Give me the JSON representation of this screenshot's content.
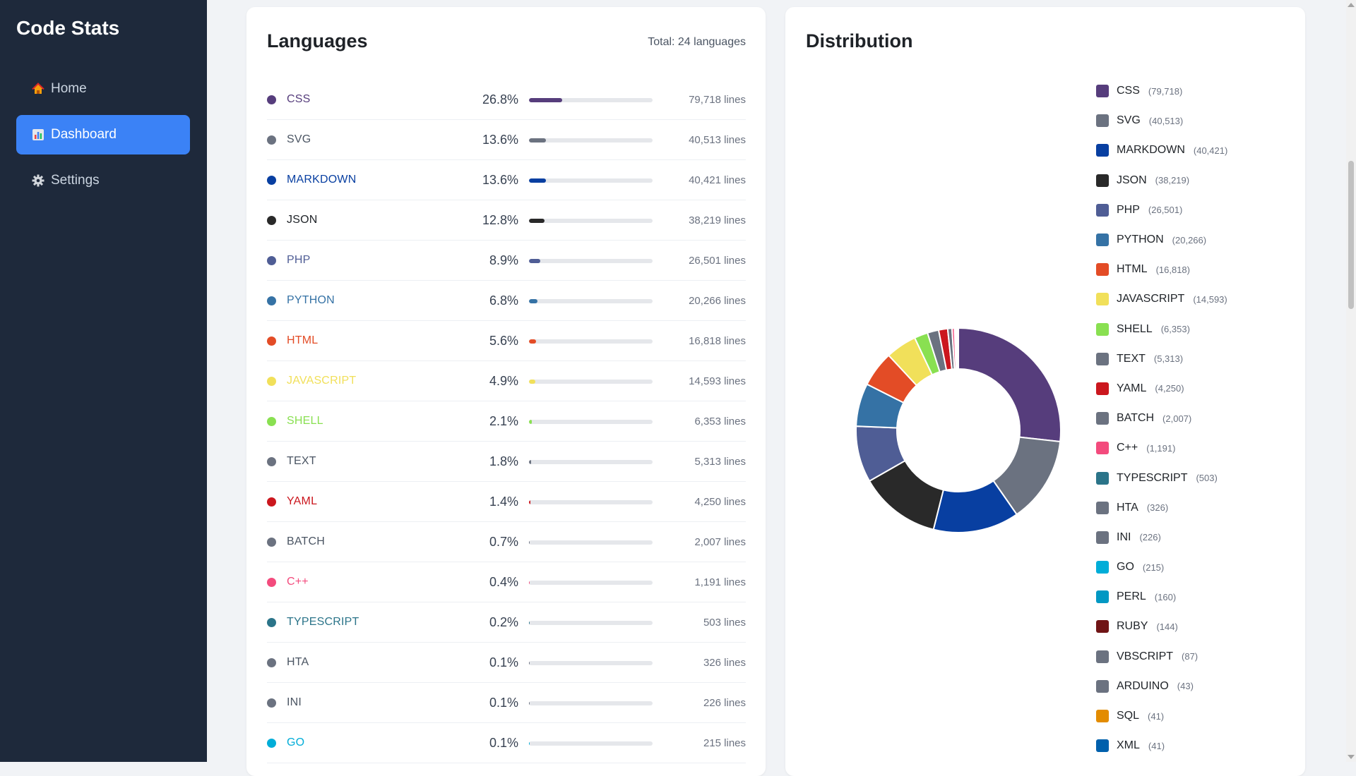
{
  "app": {
    "title": "Code Stats"
  },
  "nav": [
    {
      "label": "Home",
      "icon": "home-icon",
      "active": false
    },
    {
      "label": "Dashboard",
      "icon": "chart-icon",
      "active": true
    },
    {
      "label": "Settings",
      "icon": "gear-icon",
      "active": false
    }
  ],
  "languages_card": {
    "title": "Languages",
    "total": "Total: 24 languages"
  },
  "distribution_card": {
    "title": "Distribution"
  },
  "languages": [
    {
      "name": "CSS",
      "pct": "26.8%",
      "pct_value": 26.8,
      "lines": "79,718 lines",
      "count": "(79,718)",
      "color": "#563d7c"
    },
    {
      "name": "SVG",
      "pct": "13.6%",
      "pct_value": 13.6,
      "lines": "40,513 lines",
      "count": "(40,513)",
      "color": "#6b7280"
    },
    {
      "name": "MARKDOWN",
      "pct": "13.6%",
      "pct_value": 13.6,
      "lines": "40,421 lines",
      "count": "(40,421)",
      "color": "#083fa1"
    },
    {
      "name": "JSON",
      "pct": "12.8%",
      "pct_value": 12.8,
      "lines": "38,219 lines",
      "count": "(38,219)",
      "color": "#292929"
    },
    {
      "name": "PHP",
      "pct": "8.9%",
      "pct_value": 8.9,
      "lines": "26,501 lines",
      "count": "(26,501)",
      "color": "#4f5d95"
    },
    {
      "name": "PYTHON",
      "pct": "6.8%",
      "pct_value": 6.8,
      "lines": "20,266 lines",
      "count": "(20,266)",
      "color": "#3572a5"
    },
    {
      "name": "HTML",
      "pct": "5.6%",
      "pct_value": 5.6,
      "lines": "16,818 lines",
      "count": "(16,818)",
      "color": "#e34c26"
    },
    {
      "name": "JAVASCRIPT",
      "pct": "4.9%",
      "pct_value": 4.9,
      "lines": "14,593 lines",
      "count": "(14,593)",
      "color": "#f1e05a"
    },
    {
      "name": "SHELL",
      "pct": "2.1%",
      "pct_value": 2.1,
      "lines": "6,353 lines",
      "count": "(6,353)",
      "color": "#89e051"
    },
    {
      "name": "TEXT",
      "pct": "1.8%",
      "pct_value": 1.8,
      "lines": "5,313 lines",
      "count": "(5,313)",
      "color": "#6b7280"
    },
    {
      "name": "YAML",
      "pct": "1.4%",
      "pct_value": 1.4,
      "lines": "4,250 lines",
      "count": "(4,250)",
      "color": "#cb171e"
    },
    {
      "name": "BATCH",
      "pct": "0.7%",
      "pct_value": 0.7,
      "lines": "2,007 lines",
      "count": "(2,007)",
      "color": "#6b7280"
    },
    {
      "name": "C++",
      "pct": "0.4%",
      "pct_value": 0.4,
      "lines": "1,191 lines",
      "count": "(1,191)",
      "color": "#f34b7d"
    },
    {
      "name": "TYPESCRIPT",
      "pct": "0.2%",
      "pct_value": 0.2,
      "lines": "503 lines",
      "count": "(503)",
      "color": "#2b7489"
    },
    {
      "name": "HTA",
      "pct": "0.1%",
      "pct_value": 0.1,
      "lines": "326 lines",
      "count": "(326)",
      "color": "#6b7280"
    },
    {
      "name": "INI",
      "pct": "0.1%",
      "pct_value": 0.1,
      "lines": "226 lines",
      "count": "(226)",
      "color": "#6b7280"
    },
    {
      "name": "GO",
      "pct": "0.1%",
      "pct_value": 0.1,
      "lines": "215 lines",
      "count": "(215)",
      "color": "#00add8"
    }
  ],
  "legend_extra": [
    {
      "name": "PERL",
      "count": "(160)",
      "color": "#0298c3"
    },
    {
      "name": "RUBY",
      "count": "(144)",
      "color": "#701516"
    },
    {
      "name": "VBSCRIPT",
      "count": "(87)",
      "color": "#6b7280"
    },
    {
      "name": "ARDUINO",
      "count": "(43)",
      "color": "#6b7280"
    },
    {
      "name": "SQL",
      "count": "(41)",
      "color": "#e38c00"
    },
    {
      "name": "XML",
      "count": "(41)",
      "color": "#0060ac"
    }
  ],
  "chart_data": {
    "type": "pie",
    "donut": true,
    "categories": [
      "CSS",
      "SVG",
      "MARKDOWN",
      "JSON",
      "PHP",
      "PYTHON",
      "HTML",
      "JAVASCRIPT",
      "SHELL",
      "TEXT",
      "YAML",
      "BATCH",
      "C++",
      "TYPESCRIPT",
      "HTA",
      "INI",
      "GO",
      "PERL",
      "RUBY",
      "VBSCRIPT",
      "ARDUINO",
      "SQL",
      "XML"
    ],
    "values": [
      79718,
      40513,
      40421,
      38219,
      26501,
      20266,
      16818,
      14593,
      6353,
      5313,
      4250,
      2007,
      1191,
      503,
      326,
      226,
      215,
      160,
      144,
      87,
      43,
      41,
      41
    ],
    "colors": [
      "#563d7c",
      "#6b7280",
      "#083fa1",
      "#292929",
      "#4f5d95",
      "#3572a5",
      "#e34c26",
      "#f1e05a",
      "#89e051",
      "#6b7280",
      "#cb171e",
      "#6b7280",
      "#f34b7d",
      "#2b7489",
      "#6b7280",
      "#6b7280",
      "#00add8",
      "#0298c3",
      "#701516",
      "#6b7280",
      "#6b7280",
      "#e38c00",
      "#0060ac"
    ],
    "legend_position": "right"
  }
}
